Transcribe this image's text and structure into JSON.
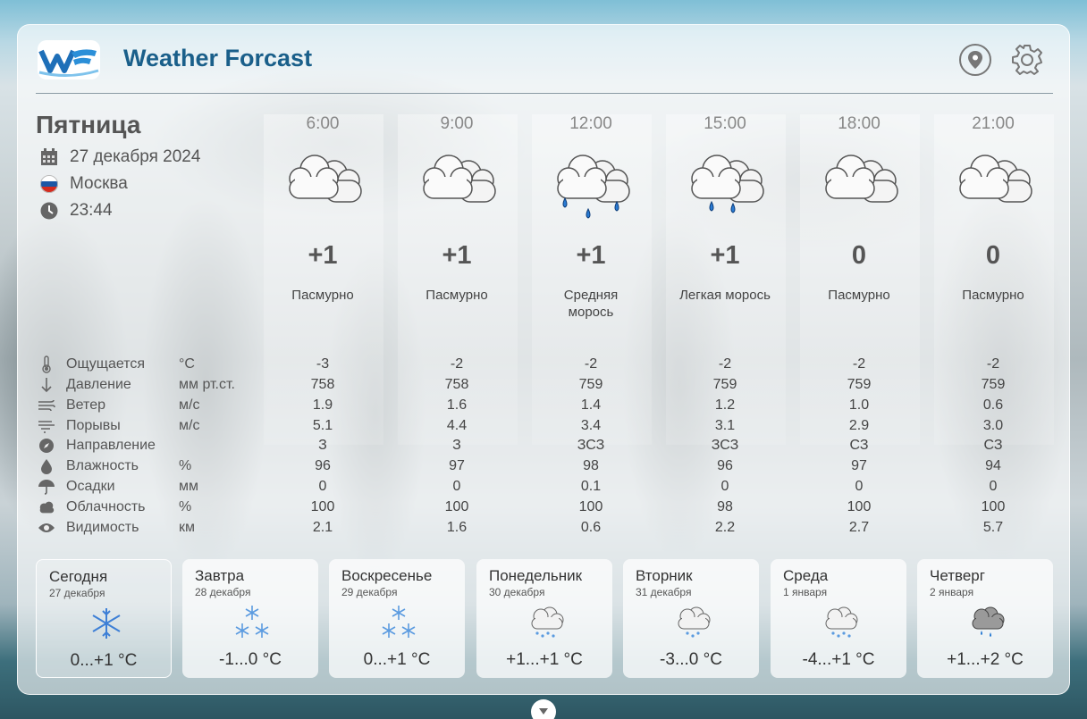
{
  "app": {
    "title": "Weather Forcast",
    "logo_text": "WF"
  },
  "header": {
    "location_icon": "map-pin-icon",
    "settings_icon": "gear-icon"
  },
  "today": {
    "day_name": "Пятница",
    "date": "27 декабря 2024",
    "city": "Москва",
    "time": "23:44"
  },
  "hours": [
    {
      "time": "6:00",
      "temp": "+1",
      "condition": "Пасмурно",
      "icon": "cloudy-icon"
    },
    {
      "time": "9:00",
      "temp": "+1",
      "condition": "Пасмурно",
      "icon": "cloudy-icon"
    },
    {
      "time": "12:00",
      "temp": "+1",
      "condition": "Средняя морось",
      "icon": "drizzle-icon"
    },
    {
      "time": "15:00",
      "temp": "+1",
      "condition": "Легкая морось",
      "icon": "light-drizzle-icon"
    },
    {
      "time": "18:00",
      "temp": "0",
      "condition": "Пасмурно",
      "icon": "cloudy-icon"
    },
    {
      "time": "21:00",
      "temp": "0",
      "condition": "Пасмурно",
      "icon": "cloudy-icon"
    }
  ],
  "params": [
    {
      "name": "Ощущается",
      "unit": "°C",
      "icon": "thermometer-icon",
      "values": [
        "-3",
        "-2",
        "-2",
        "-2",
        "-2",
        "-2"
      ]
    },
    {
      "name": "Давление",
      "unit": "мм рт.ст.",
      "icon": "arrow-down-icon",
      "values": [
        "758",
        "758",
        "759",
        "759",
        "759",
        "759"
      ]
    },
    {
      "name": "Ветер",
      "unit": "м/с",
      "icon": "wind-icon",
      "values": [
        "1.9",
        "1.6",
        "1.4",
        "1.2",
        "1.0",
        "0.6"
      ]
    },
    {
      "name": "Порывы",
      "unit": "м/с",
      "icon": "gust-icon",
      "values": [
        "5.1",
        "4.4",
        "3.4",
        "3.1",
        "2.9",
        "3.0"
      ]
    },
    {
      "name": "Направление",
      "unit": "",
      "icon": "compass-icon",
      "values": [
        "З",
        "З",
        "ЗСЗ",
        "ЗСЗ",
        "СЗ",
        "СЗ"
      ]
    },
    {
      "name": "Влажность",
      "unit": "%",
      "icon": "droplet-icon",
      "values": [
        "96",
        "97",
        "98",
        "96",
        "97",
        "94"
      ]
    },
    {
      "name": "Осадки",
      "unit": "мм",
      "icon": "umbrella-icon",
      "values": [
        "0",
        "0",
        "0.1",
        "0",
        "0",
        "0"
      ]
    },
    {
      "name": "Облачность",
      "unit": "%",
      "icon": "cloud-icon",
      "values": [
        "100",
        "100",
        "100",
        "98",
        "100",
        "100"
      ]
    },
    {
      "name": "Видимость",
      "unit": "км",
      "icon": "eye-icon",
      "values": [
        "2.1",
        "1.6",
        "0.6",
        "2.2",
        "2.7",
        "5.7"
      ]
    }
  ],
  "forecast": [
    {
      "day": "Сегодня",
      "date": "27 декабря",
      "temp": "0...+1 °C",
      "icon": "snowflake-icon"
    },
    {
      "day": "Завтра",
      "date": "28 декабря",
      "temp": "-1...0 °C",
      "icon": "snowflakes-icon"
    },
    {
      "day": "Воскресенье",
      "date": "29 декабря",
      "temp": "0...+1 °C",
      "icon": "snowflakes-icon"
    },
    {
      "day": "Понедельник",
      "date": "30 декабря",
      "temp": "+1...+1 °C",
      "icon": "cloud-snow-icon"
    },
    {
      "day": "Вторник",
      "date": "31 декабря",
      "temp": "-3...0 °C",
      "icon": "cloud-snow-icon"
    },
    {
      "day": "Среда",
      "date": "1 января",
      "temp": "-4...+1 °C",
      "icon": "cloud-snow-icon"
    },
    {
      "day": "Четверг",
      "date": "2 января",
      "temp": "+1...+2 °C",
      "icon": "cloud-rain-icon"
    }
  ],
  "colors": {
    "accent": "#1a5f8a",
    "rain": "#2a7bd3"
  }
}
